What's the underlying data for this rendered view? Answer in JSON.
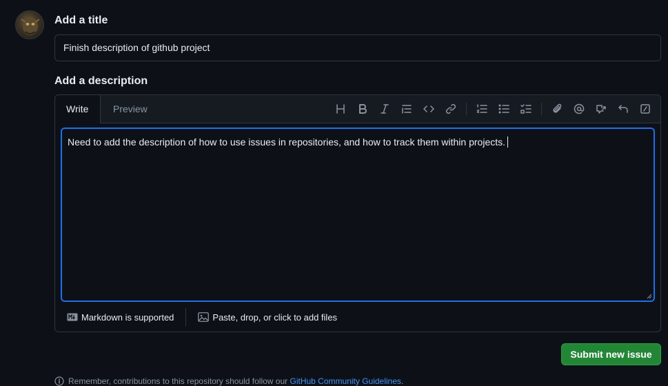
{
  "form": {
    "title_label": "Add a title",
    "title_value": "Finish description of github project",
    "description_label": "Add a description"
  },
  "editor": {
    "tabs": [
      {
        "label": "Write",
        "active": true
      },
      {
        "label": "Preview",
        "active": false
      }
    ],
    "toolbar_icons": [
      "heading-icon",
      "bold-icon",
      "italic-icon",
      "quote-icon",
      "code-icon",
      "link-icon",
      "ordered-list-icon",
      "unordered-list-icon",
      "task-list-icon",
      "attach-icon",
      "mention-icon",
      "reference-icon",
      "undo-icon",
      "slash-command-icon"
    ],
    "body_text": "Need to add the description of how to use issues in repositories, and how to track them within projects.",
    "markdown_note": "Markdown is supported",
    "attach_note": "Paste, drop, or click to add files"
  },
  "actions": {
    "submit_label": "Submit new issue"
  },
  "footer": {
    "note_prefix": "Remember, contributions to this repository should follow our",
    "note_link": "GitHub Community Guidelines",
    "note_suffix": "."
  },
  "colors": {
    "background": "#0d1117",
    "accent": "#1f6feb",
    "submit": "#238636",
    "link": "#4493f8"
  }
}
